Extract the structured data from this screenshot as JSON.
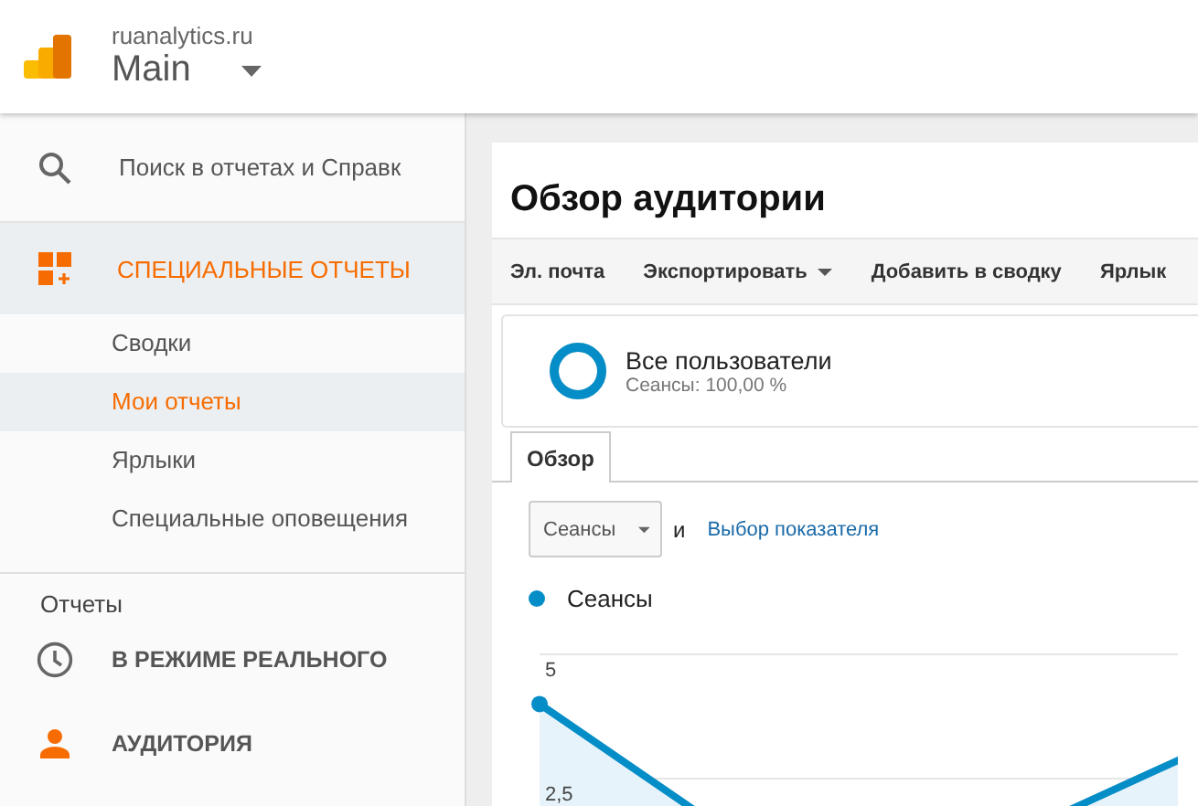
{
  "header": {
    "site": "ruanalytics.ru",
    "view": "Main"
  },
  "sidebar": {
    "search": {
      "placeholder": "Поиск в отчетах и Справк"
    },
    "custom_reports": {
      "label": "СПЕЦИАЛЬНЫЕ ОТЧЕТЫ",
      "selected": true,
      "children": [
        {
          "label": "Сводки",
          "selected": false
        },
        {
          "label": "Мои отчеты",
          "selected": true
        },
        {
          "label": "Ярлыки",
          "selected": false
        },
        {
          "label": "Специальные оповещения",
          "selected": false
        }
      ]
    },
    "reports_heading": "Отчеты",
    "sections": [
      {
        "kind": "realtime",
        "label": "В РЕЖИМЕ РЕАЛЬНОГО"
      },
      {
        "kind": "audience",
        "label": "АУДИТОРИЯ"
      }
    ]
  },
  "main": {
    "title": "Обзор аудитории",
    "toolbar": [
      {
        "label": "Эл. почта",
        "dropdown": false
      },
      {
        "label": "Экспортировать",
        "dropdown": true
      },
      {
        "label": "Добавить в сводку",
        "dropdown": false
      },
      {
        "label": "Ярлык",
        "dropdown": false
      }
    ],
    "segment": {
      "name": "Все пользователи",
      "detail": "Сеансы: 100,00 %",
      "level": 1
    },
    "tabs": [
      {
        "label": "Обзор",
        "selected": true
      }
    ],
    "metric": {
      "value": "Сеансы",
      "joiner": "и",
      "link": "Выбор показателя"
    },
    "chart": {
      "legend": "Сеансы",
      "axis_labels": [
        "5",
        "2,5"
      ]
    }
  }
}
